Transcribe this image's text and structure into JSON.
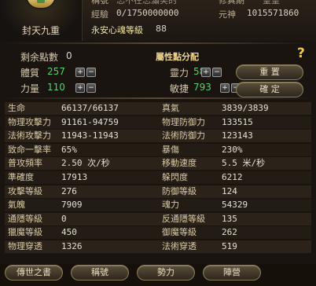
{
  "header": {
    "character_title": "封天九重",
    "title_label": "稱號",
    "title_value": "忘不在忘瀟笑的",
    "exp_label": "經驗",
    "exp_value": "0/1750000000",
    "cultivation_label": "修真期",
    "cultivation_value": "皇皇",
    "soul_label": "元神",
    "soul_value": "1015571860",
    "heart_label": "永安心魂等級",
    "heart_value": "88"
  },
  "allocation": {
    "remaining_label": "剩余點數",
    "remaining_value": "0",
    "title": "屬性點分配",
    "stats": [
      {
        "label": "體質",
        "value": "257"
      },
      {
        "label": "力量",
        "value": "110"
      },
      {
        "label": "靈力",
        "value": "58"
      },
      {
        "label": "敏捷",
        "value": "793"
      }
    ],
    "plus": "+",
    "minus": "−",
    "reset_label": "重 置",
    "confirm_label": "確 定",
    "help": "?"
  },
  "stats": [
    {
      "l1": "生命",
      "v1": "66137/66137",
      "l2": "真氣",
      "v2": "3839/3839"
    },
    {
      "l1": "物理攻擊力",
      "v1": "91161-94759",
      "l2": "物理防御力",
      "v2": "133515"
    },
    {
      "l1": "法術攻擊力",
      "v1": "11943-11943",
      "l2": "法術防御力",
      "v2": "123143"
    },
    {
      "l1": "致命一擊率",
      "v1": "65%",
      "l2": "暴傷",
      "v2": "230%"
    },
    {
      "l1": "普攻頻率",
      "v1": "2.50 次/秒",
      "l2": "移動速度",
      "v2": "5.5 米/秒"
    },
    {
      "l1": "準確度",
      "v1": "17913",
      "l2": "躲閃度",
      "v2": "6212"
    },
    {
      "l1": "攻擊等級",
      "v1": "276",
      "l2": "防御等級",
      "v2": "124"
    },
    {
      "l1": "氣魄",
      "v1": "7909",
      "l2": "魂力",
      "v2": "54329"
    },
    {
      "l1": "通隱等級",
      "v1": "0",
      "l2": "反通隱等級",
      "v2": "135"
    },
    {
      "l1": "獵魔等級",
      "v1": "450",
      "l2": "御魔等級",
      "v2": "262"
    },
    {
      "l1": "物理穿透",
      "v1": "1326",
      "l2": "法術穿透",
      "v2": "519"
    }
  ],
  "tabs": [
    {
      "label": "傳世之書"
    },
    {
      "label": "稱號"
    },
    {
      "label": "勢力"
    },
    {
      "label": "陣營"
    }
  ],
  "colors": {
    "accent_green": "#53d26a",
    "gold": "#f0d78a",
    "panel": "#2b231a"
  }
}
